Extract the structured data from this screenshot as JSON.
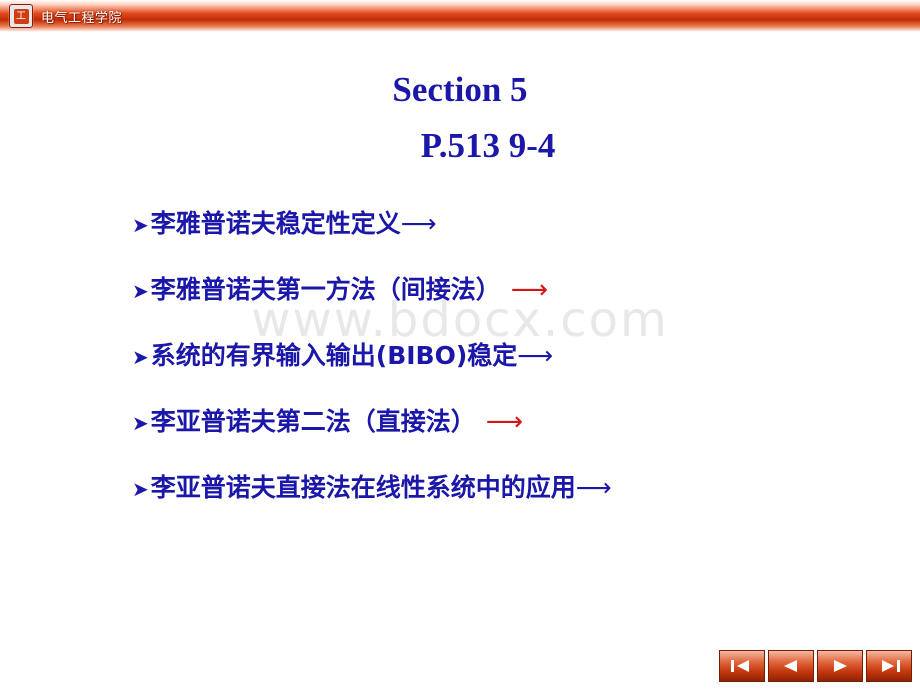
{
  "header": {
    "logo_text": "工",
    "school_name": "电气工程学院"
  },
  "watermark": "www.bdocx.com",
  "title": {
    "line1": "Section 5",
    "line2": "P.513 9-4"
  },
  "bullets": [
    {
      "marker": "➤",
      "text": "李雅普诺夫稳定性定义",
      "arrow": "⟶",
      "arrow_color": "blue"
    },
    {
      "marker": "➤",
      "text": "李雅普诺夫第一方法（间接法）",
      "arrow": "⟶",
      "arrow_color": "red"
    },
    {
      "marker": "➤",
      "text": "系统的有界输入输出(BIBO)稳定",
      "arrow": "⟶",
      "arrow_color": "blue"
    },
    {
      "marker": "➤",
      "text": "李亚普诺夫第二法（直接法）",
      "arrow": "⟶",
      "arrow_color": "red"
    },
    {
      "marker": "➤",
      "text": "李亚普诺夫直接法在线性系统中的应用",
      "arrow": "⟶",
      "arrow_color": "blue"
    }
  ],
  "nav": [
    {
      "name": "first-slide-button",
      "glyph": "first"
    },
    {
      "name": "previous-slide-button",
      "glyph": "previous"
    },
    {
      "name": "next-slide-button",
      "glyph": "next"
    },
    {
      "name": "last-slide-button",
      "glyph": "last"
    }
  ],
  "colors": {
    "title_blue": "#1b17a8",
    "arrow_red": "#d81414",
    "banner_red": "#c22c06",
    "watermark_gray": "#e8e8e8"
  }
}
